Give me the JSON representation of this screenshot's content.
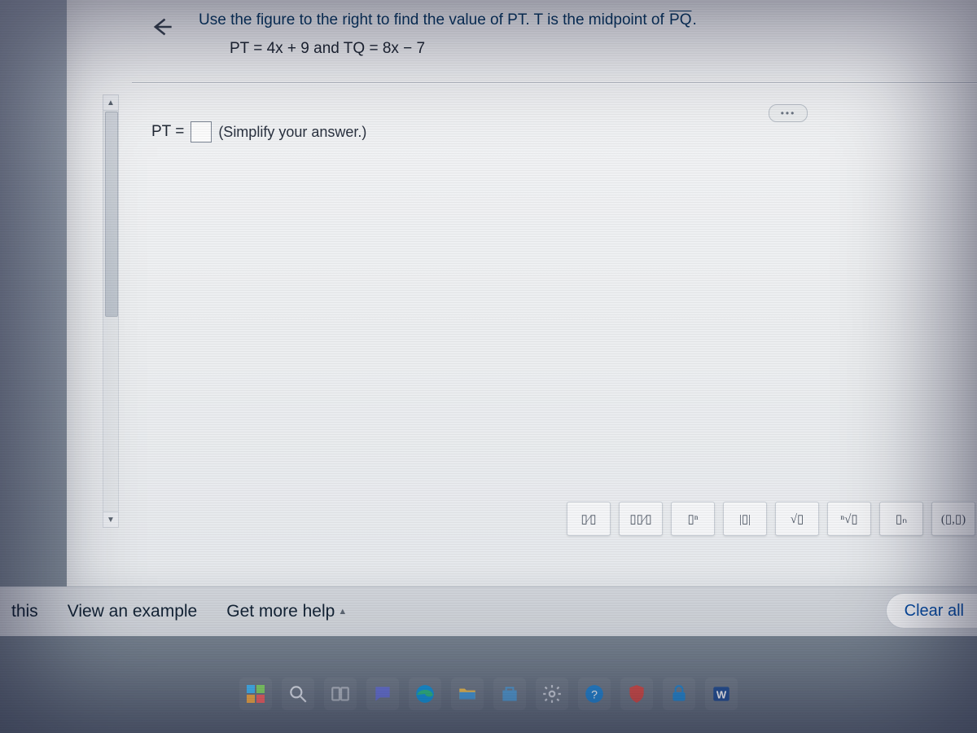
{
  "question": {
    "prompt_prefix": "Use the figure to the right to find the value of PT. T is the midpoint of ",
    "segment_label": "PQ",
    "prompt_suffix": ".",
    "given": "PT = 4x + 9 and TQ = 8x − 7"
  },
  "answer": {
    "label_lhs": "PT =",
    "hint": "(Simplify your answer.)"
  },
  "ellipsis": "•••",
  "math_palette": {
    "items": [
      {
        "name": "fraction-btn",
        "label": "▯⁄▯"
      },
      {
        "name": "mixed-fraction-btn",
        "label": "▯▯⁄▯"
      },
      {
        "name": "exponent-btn",
        "label": "▯ⁿ"
      },
      {
        "name": "absolute-value-btn",
        "label": "|▯|"
      },
      {
        "name": "square-root-btn",
        "label": "√▯"
      },
      {
        "name": "nth-root-btn",
        "label": "ⁿ√▯"
      },
      {
        "name": "subscript-btn",
        "label": "▯ₙ"
      },
      {
        "name": "ordered-pair-btn",
        "label": "(▯,▯)"
      }
    ]
  },
  "footer": {
    "this": "this",
    "view_example": "View an example",
    "get_more_help": "Get more help",
    "clear_all": "Clear all"
  },
  "taskbar": {
    "items": [
      {
        "name": "start-icon"
      },
      {
        "name": "search-icon"
      },
      {
        "name": "task-view-icon"
      },
      {
        "name": "chat-icon"
      },
      {
        "name": "edge-icon"
      },
      {
        "name": "file-explorer-icon"
      },
      {
        "name": "store-icon"
      },
      {
        "name": "settings-icon"
      },
      {
        "name": "tips-icon"
      },
      {
        "name": "shield-icon"
      },
      {
        "name": "security-icon"
      },
      {
        "name": "word-icon"
      }
    ]
  }
}
